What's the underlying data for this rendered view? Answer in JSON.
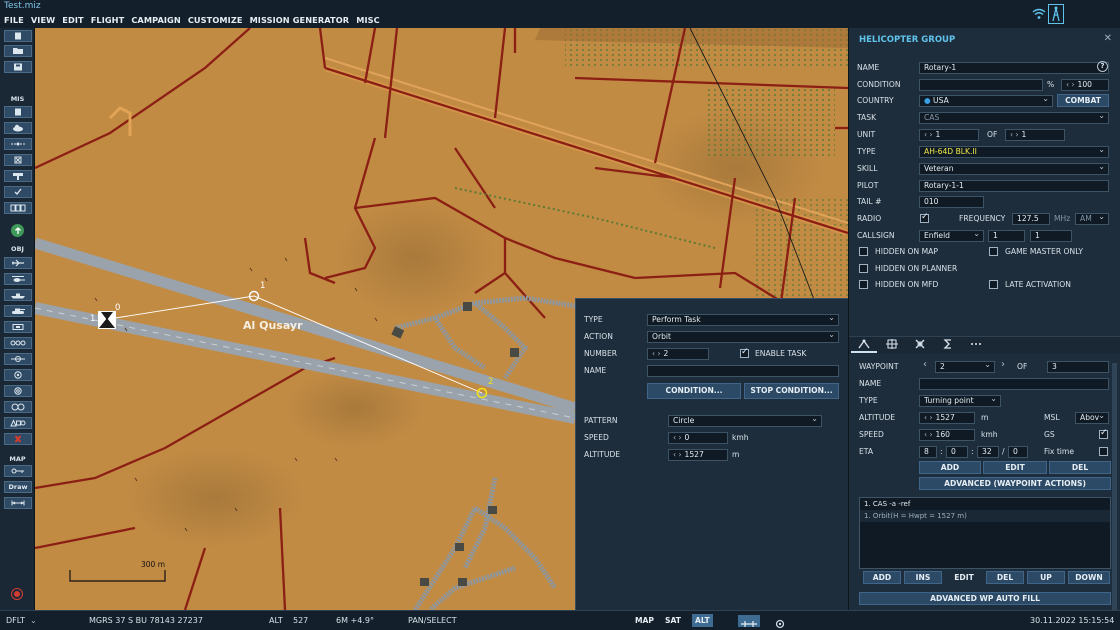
{
  "title": "Test.miz",
  "menu": [
    "FILE",
    "VIEW",
    "EDIT",
    "FLIGHT",
    "CAMPAIGN",
    "CUSTOMIZE",
    "MISSION GENERATOR",
    "MISC"
  ],
  "toolbar": {
    "mis_label": "MIS",
    "obj_label": "OBJ",
    "map_label": "MAP",
    "draw_label": "Draw"
  },
  "map": {
    "town_label": "Al Qusayr",
    "scale_label": "300 m",
    "wp0": "0",
    "wp1": "1",
    "wp2": "2",
    "group_num": "1"
  },
  "task_panel": {
    "type_label": "TYPE",
    "type_value": "Perform Task",
    "action_label": "ACTION",
    "action_value": "Orbit",
    "number_label": "NUMBER",
    "number_value": "2",
    "enable_task_label": "ENABLE TASK",
    "name_label": "NAME",
    "name_value": "",
    "condition_btn": "CONDITION...",
    "stop_condition_btn": "STOP CONDITION...",
    "pattern_label": "PATTERN",
    "pattern_value": "Circle",
    "speed_label": "SPEED",
    "speed_value": "0",
    "speed_unit": "kmh",
    "altitude_label": "ALTITUDE",
    "altitude_value": "1527",
    "altitude_unit": "m"
  },
  "group_panel": {
    "title": "HELICOPTER GROUP",
    "name_label": "NAME",
    "name_value": "Rotary-1",
    "condition_label": "CONDITION",
    "condition_value": "",
    "condition_pct": "%",
    "condition_num": "100",
    "country_label": "COUNTRY",
    "country_value": "USA",
    "combat_btn": "COMBAT",
    "task_label": "TASK",
    "task_value": "CAS",
    "unit_label": "UNIT",
    "unit_value": "1",
    "unit_of": "OF",
    "unit_total": "1",
    "type_label": "TYPE",
    "type_value": "AH-64D BLK.II",
    "skill_label": "SKILL",
    "skill_value": "Veteran",
    "pilot_label": "PILOT",
    "pilot_value": "Rotary-1-1",
    "tail_label": "TAIL #",
    "tail_value": "010",
    "radio_label": "RADIO",
    "frequency_label": "FREQUENCY",
    "frequency_value": "127.5",
    "frequency_unit": "MHz",
    "modulation": "AM",
    "callsign_label": "CALLSIGN",
    "callsign_value": "Enfield",
    "callsign_n1": "1",
    "callsign_n2": "1",
    "hidden_map": "HIDDEN ON MAP",
    "game_master": "GAME MASTER ONLY",
    "hidden_planner": "HIDDEN ON PLANNER",
    "hidden_mfd": "HIDDEN ON MFD",
    "late_activation": "LATE ACTIVATION"
  },
  "waypoint": {
    "waypoint_label": "WAYPOINT",
    "waypoint_value": "2",
    "of_label": "OF",
    "of_value": "3",
    "name_label": "NAME",
    "name_value": "",
    "type_label": "TYPE",
    "type_value": "Turning point",
    "altitude_label": "ALTITUDE",
    "altitude_value": "1527",
    "altitude_unit": "m",
    "alt_ref": "MSL",
    "alt_mode": "Abov",
    "speed_label": "SPEED",
    "speed_value": "160",
    "speed_unit": "kmh",
    "gs_label": "GS",
    "eta_label": "ETA",
    "eta_h": "8",
    "eta_m": "0",
    "eta_s": "32",
    "eta_d": "0",
    "fix_time": "Fix time",
    "add_btn": "ADD",
    "edit_btn": "EDIT",
    "del_btn": "DEL",
    "advanced_btn": "ADVANCED (WAYPOINT ACTIONS)",
    "actions": [
      "1. CAS -a -ref",
      "1. Orbit(H = Hwpt = 1527 m)"
    ],
    "list_add": "ADD",
    "list_ins": "INS",
    "list_edit": "EDIT",
    "list_del": "DEL",
    "list_up": "UP",
    "list_down": "DOWN",
    "auto_fill_btn": "ADVANCED WP AUTO FILL"
  },
  "status": {
    "profile": "DFLT",
    "coords": "MGRS  37 S BU 78143 27237",
    "alt_label": "ALT",
    "alt_value": "527",
    "wind": "6M  +4.9°",
    "mode": "PAN/SELECT",
    "map_btn": "MAP",
    "sat_btn": "SAT",
    "alt_btn": "ALT",
    "datetime": "30.11.2022 15:15:54"
  },
  "colors": {
    "accent": "#5fc3ec",
    "road": "#8b1f14",
    "sand": "#c18b45",
    "airfield": "#8e9aa3",
    "waypoint_active": "#f2e318"
  }
}
